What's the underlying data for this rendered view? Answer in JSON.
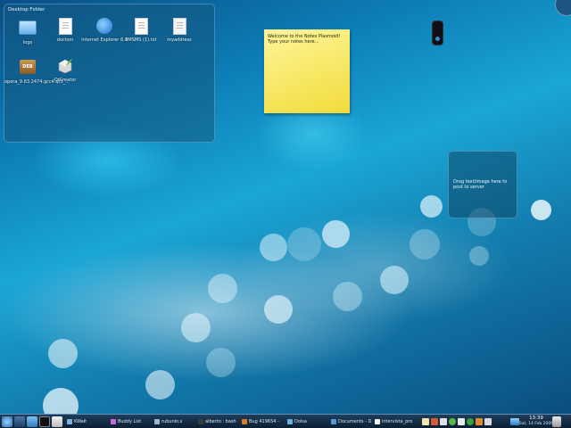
{
  "folder_view": {
    "title": "Desktop Folder",
    "icons": [
      {
        "label": "logs",
        "kind": "folder-icon"
      },
      {
        "label": "doctsm",
        "kind": "document-icon"
      },
      {
        "label": "Internet Explorer 6.0",
        "kind": "internet-explorer-icon"
      },
      {
        "label": "IIMSMS (1).txt",
        "kind": "document-icon"
      },
      {
        "label": "myaddress",
        "kind": "contact-document-icon"
      },
      {
        "label": "opera_9.63.2474.gcc4.qt3_...",
        "kind": "deb-package-icon"
      },
      {
        "label": "QtCreator",
        "kind": "qtcreator-icon"
      }
    ]
  },
  "sticky_note": {
    "line1": "Welcome to the Notes Plasmoid!",
    "line2": "Type your notes here..."
  },
  "pastebin": {
    "text": "Drag text/image here to post to server"
  },
  "taskbar": {
    "tasks": [
      {
        "label": "KWait",
        "color": "#7bb2dd"
      },
      {
        "label": "Buddy List",
        "color": "#c46bd6"
      },
      {
        "label": "rubunio.s",
        "color": "#9fb9c9"
      },
      {
        "label": "alberto : bash",
        "color": "#3b3b3b"
      },
      {
        "label": "Bug 419654 -",
        "color": "#e07b21"
      },
      {
        "label": "Dolsa",
        "color": "#6ab0e0"
      },
      {
        "label": "Documents - D",
        "color": "#5a9bd5"
      },
      {
        "label": "intervista_pro",
        "color": "#f2f2f2"
      }
    ],
    "clock": {
      "time": "13:39",
      "date": "Sat, 14 Feb 2009"
    }
  },
  "colors": {
    "sticky": "#f6e64e",
    "panel": "#17324c",
    "accent": "#1aa6d6"
  }
}
